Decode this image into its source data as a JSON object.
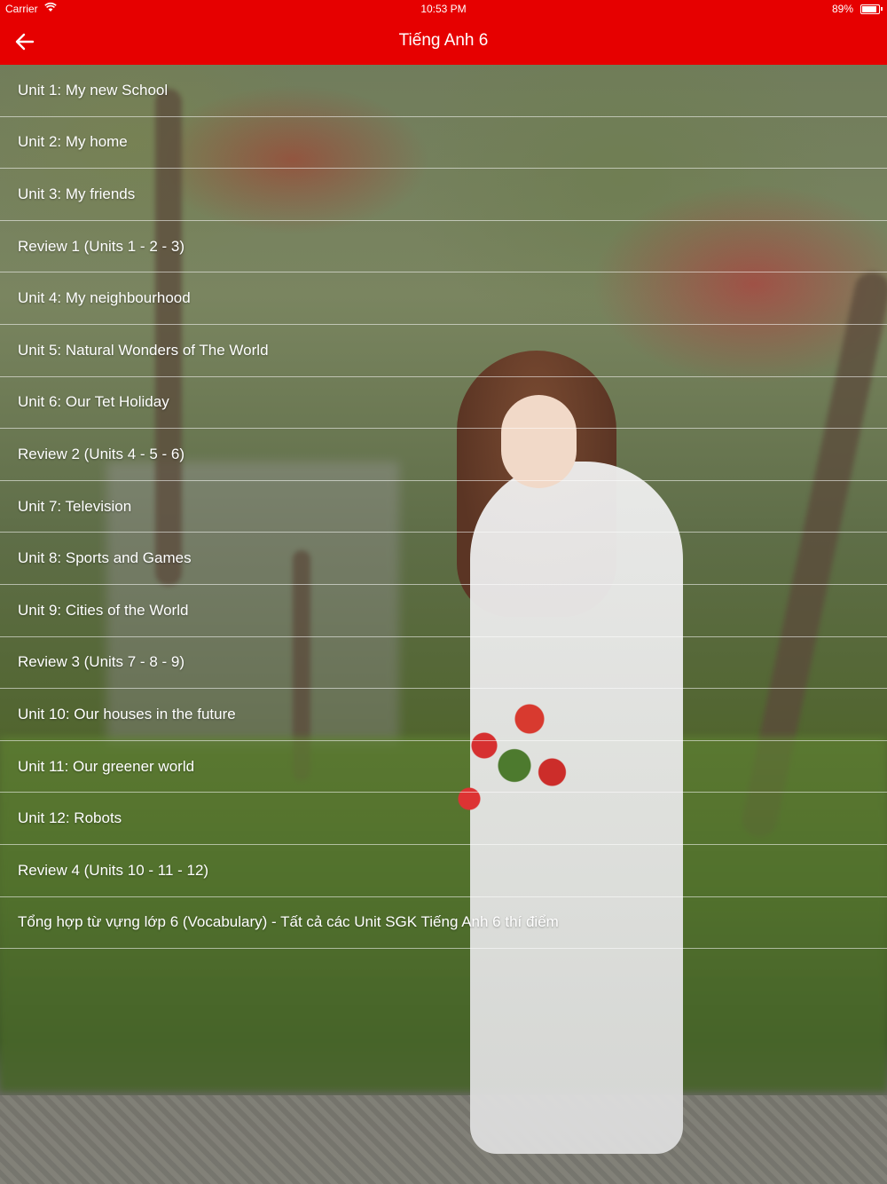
{
  "status_bar": {
    "carrier": "Carrier",
    "time": "10:53 PM",
    "battery": "89%",
    "wifi_icon": "wifi-icon",
    "battery_icon": "battery-icon"
  },
  "nav": {
    "title": "Tiếng Anh 6",
    "back_icon": "arrow-left-icon",
    "color": "#e60000"
  },
  "units": [
    "Unit 1: My new School",
    "Unit 2: My home",
    "Unit 3: My friends",
    "Review 1 (Units 1 - 2 - 3)",
    "Unit 4: My neighbourhood",
    "Unit 5: Natural Wonders of The World",
    "Unit 6: Our Tet Holiday",
    "Review 2 (Units 4 - 5 - 6)",
    "Unit 7: Television",
    "Unit 8: Sports and Games",
    "Unit 9: Cities of the World",
    "Review 3 (Units 7 - 8 - 9)",
    "Unit 10: Our houses in the future",
    "Unit 11: Our greener world",
    "Unit 12: Robots",
    "Review 4 (Units 10 - 11 - 12)",
    "Tổng hợp từ vựng lớp 6 (Vocabulary) - Tất cả các Unit SGK Tiếng Anh 6 thí điểm"
  ]
}
